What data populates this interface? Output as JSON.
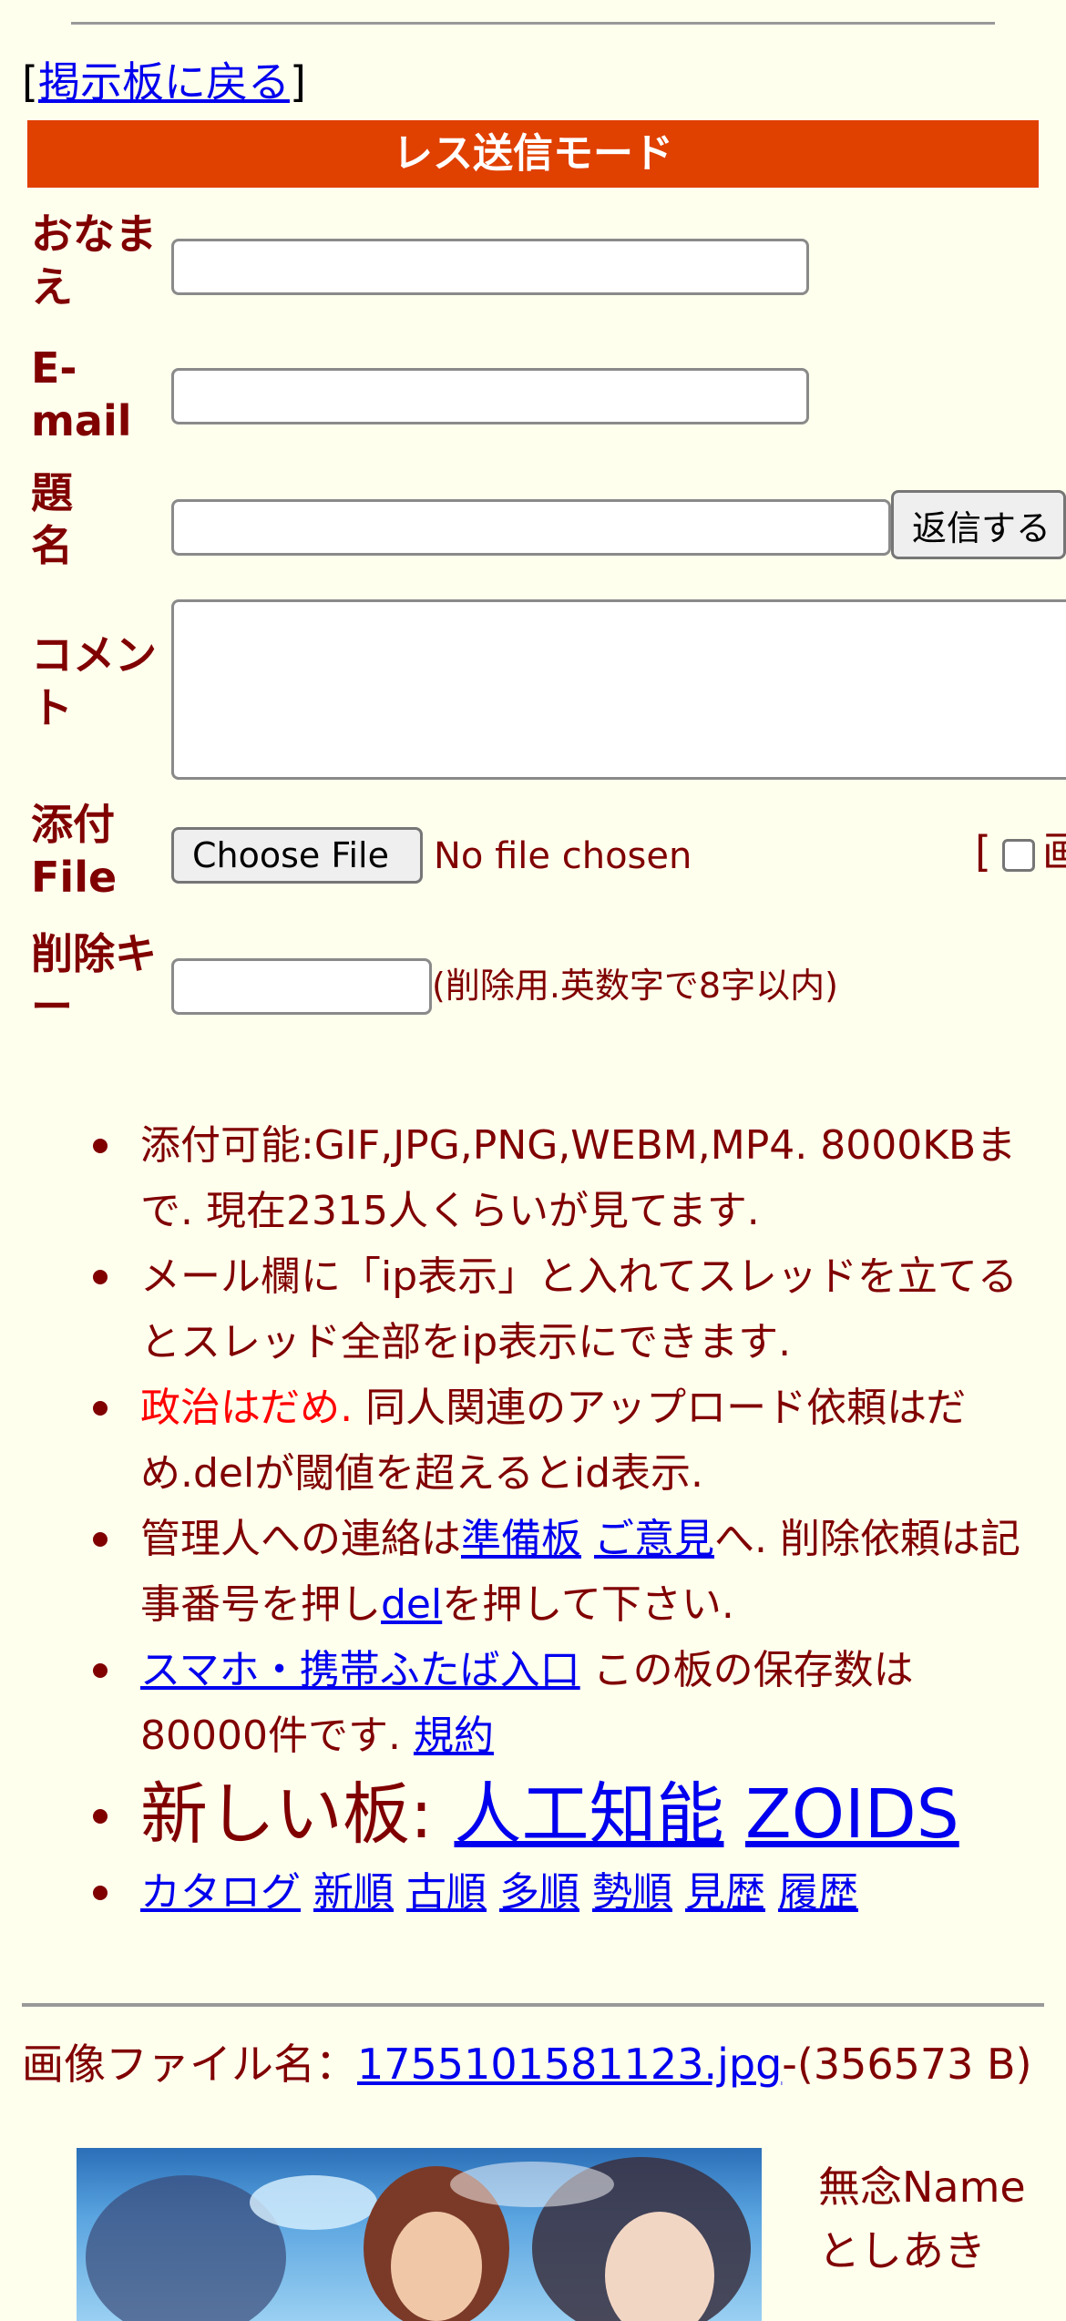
{
  "back_link": {
    "open": "[",
    "label": "掲示板に戻る",
    "close": "]"
  },
  "mode_title": "レス送信モード",
  "form": {
    "name_label": "おなまえ",
    "email_label": "E-mail",
    "subject_label": "題名",
    "submit_label": "返信する",
    "comment_label": "コメント",
    "file_label": "添付File",
    "choose_file_label": "Choose File",
    "no_file_text": "No file chosen",
    "image_option_open": "[",
    "image_option_text": "画",
    "delkey_label": "削除キー",
    "delkey_note": "(削除用.英数字で8字以内)"
  },
  "rules": {
    "r1": "添付可能:GIF,JPG,PNG,WEBM,MP4. 8000KBまで. 現在2315人くらいが見てます.",
    "r2": "メール欄に「ip表示」と入れてスレッドを立てるとスレッド全部をip表示にできます.",
    "r3_red": "政治はだめ.",
    "r3_rest": " 同人関連のアップロード依頼はだめ.delが閾値を超えるとid表示.",
    "r4_a": "管理人への連絡は",
    "r4_link1": "準備板",
    "r4_link2": "ご意見",
    "r4_b": "へ. 削除依頼は記事番号を押し",
    "r4_link3": "del",
    "r4_c": "を押して下さい.",
    "r5_link": "スマホ・携帯ふたば入口",
    "r5_text": " この板の保存数は80000件です. ",
    "r5_link2": "規約",
    "r6_label": "新しい板: ",
    "r6_link1": "人工知能",
    "r6_link2": "ZOIDS",
    "nav": [
      "カタログ",
      "新順",
      "古順",
      "多順",
      "勢順",
      "見歴",
      "履歴"
    ]
  },
  "post": {
    "file_label": "画像ファイル名：",
    "file_name": "1755101581123.jpg",
    "file_size": "-(356573 B)",
    "poster_name": "無念Name",
    "poster_sub": "としあき"
  },
  "colors": {
    "background": "#ffffee",
    "text": "#800000",
    "mode_bar": "#e04000",
    "link": "#0000ee",
    "warning": "#ff0000"
  }
}
